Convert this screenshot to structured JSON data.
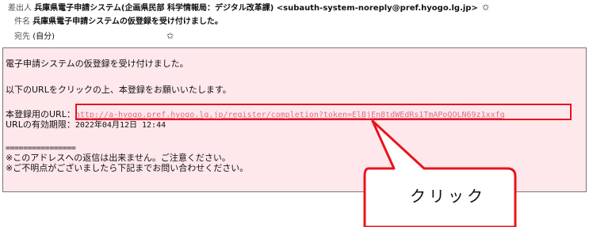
{
  "header": {
    "from_label": "差出人",
    "from_value": "兵庫県電子申請システム(企画県民部 科学情報局：デジタル改革課) <subauth-system-noreply@pref.hyogo.lg.jp>",
    "subject_label": "件名",
    "subject_value": "兵庫県電子申請システムの仮登録を受け付けました。",
    "to_label": "宛先",
    "to_value": "(自分)",
    "star_icon": "star-icon"
  },
  "body": {
    "line1": "電子申請システムの仮登録を受け付けました。",
    "line2": "以下のURLをクリックの上、本登録をお願いいたします。",
    "line3_label": "本登録用のURL：",
    "line3_link": "http://a-hyogo.pref.hyogo.lg.jp/register/completion?token=ElBjEn8tdWEdRs1TmAPoQOLN69z1xxfq",
    "line4_label": "URLの有効期限：",
    "line4_value": "2022年04月12日 12:44",
    "separator": "================",
    "line6": "※このアドレスへの返信は出来ません。ご注意ください。",
    "line7": "※ご不明点がございましたら下記までお問い合わせください。"
  },
  "annotation": {
    "callout_text": "クリック",
    "highlight_color": "#e8141c"
  }
}
